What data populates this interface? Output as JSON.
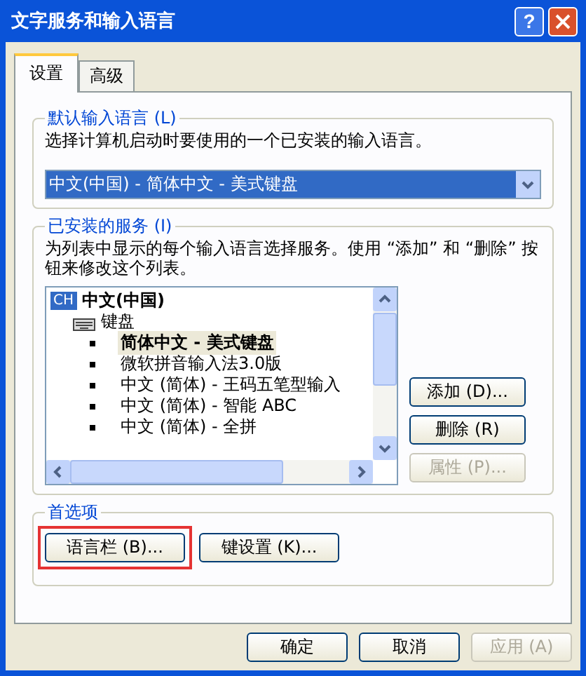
{
  "window": {
    "title": "文字服务和输入语言",
    "help_button": "?"
  },
  "tabs": [
    {
      "label": "设置",
      "selected": true
    },
    {
      "label": "高级",
      "selected": false
    }
  ],
  "default_language": {
    "title": "默认输入语言 (L)",
    "description": "选择计算机启动时要使用的一个已安装的输入语言。",
    "value": "中文(中国) - 简体中文 - 美式键盘"
  },
  "services": {
    "title": "已安装的服务 (I)",
    "description": "为列表中显示的每个输入语言选择服务。使用 “添加” 和 “删除” 按钮来修改这个列表。",
    "tree": [
      {
        "badge": "CH",
        "label": "中文(中国)",
        "children": [
          {
            "label": "键盘",
            "children": [
              {
                "label": "简体中文 - 美式键盘",
                "selected": true
              },
              {
                "label": "微软拼音输入法3.0版",
                "selected": false
              },
              {
                "label": "中文 (简体) - 王码五笔型输入",
                "selected": false
              },
              {
                "label": "中文 (简体) - 智能 ABC",
                "selected": false
              },
              {
                "label": "中文 (简体) - 全拼",
                "selected": false
              }
            ]
          }
        ]
      }
    ],
    "buttons": [
      {
        "label": "添加 (D)...",
        "disabled": false
      },
      {
        "label": "删除 (R)",
        "disabled": false
      },
      {
        "label": "属性 (P)...",
        "disabled": true
      }
    ]
  },
  "preferences": {
    "title": "首选项",
    "buttons": [
      {
        "label": "语言栏 (B)...",
        "highlighted": true
      },
      {
        "label": "键设置 (K)...",
        "highlighted": false
      }
    ]
  },
  "footer": [
    {
      "label": "确定",
      "disabled": false
    },
    {
      "label": "取消",
      "disabled": false
    },
    {
      "label": "应用 (A)",
      "disabled": true
    }
  ]
}
